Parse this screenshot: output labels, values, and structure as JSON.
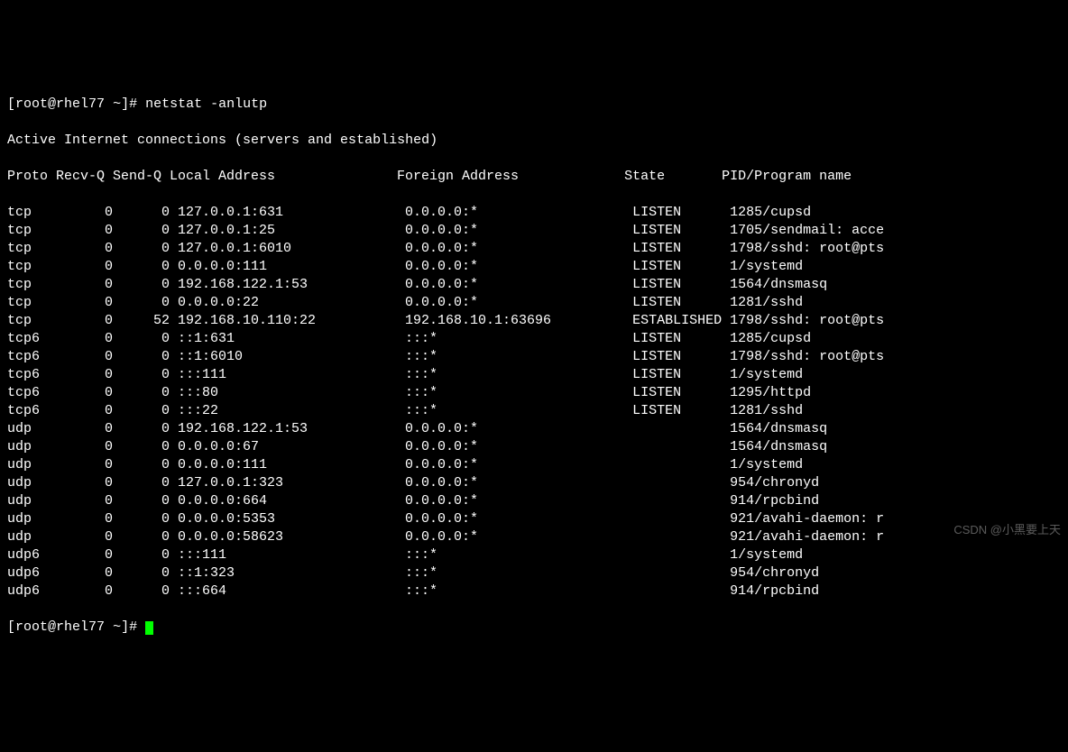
{
  "prompt1": {
    "open": "[",
    "user": "root",
    "at": "@",
    "host": "rhel77",
    "path": " ~",
    "close": "]#",
    "cmd": " netstat -anlutp"
  },
  "heading": "Active Internet connections (servers and established)",
  "cols": {
    "proto": "Proto",
    "recvq": "Recv-Q",
    "sendq": "Send-Q",
    "local": "Local Address",
    "foreign": "Foreign Address",
    "state": "State",
    "pid": "PID/Program name"
  },
  "rows": [
    {
      "proto": "tcp",
      "recvq": "0",
      "sendq": "0",
      "local": "127.0.0.1:631",
      "foreign": "0.0.0.0:*",
      "state": "LISTEN",
      "pid": "1285/cupsd"
    },
    {
      "proto": "tcp",
      "recvq": "0",
      "sendq": "0",
      "local": "127.0.0.1:25",
      "foreign": "0.0.0.0:*",
      "state": "LISTEN",
      "pid": "1705/sendmail: acce"
    },
    {
      "proto": "tcp",
      "recvq": "0",
      "sendq": "0",
      "local": "127.0.0.1:6010",
      "foreign": "0.0.0.0:*",
      "state": "LISTEN",
      "pid": "1798/sshd: root@pts"
    },
    {
      "proto": "tcp",
      "recvq": "0",
      "sendq": "0",
      "local": "0.0.0.0:111",
      "foreign": "0.0.0.0:*",
      "state": "LISTEN",
      "pid": "1/systemd"
    },
    {
      "proto": "tcp",
      "recvq": "0",
      "sendq": "0",
      "local": "192.168.122.1:53",
      "foreign": "0.0.0.0:*",
      "state": "LISTEN",
      "pid": "1564/dnsmasq"
    },
    {
      "proto": "tcp",
      "recvq": "0",
      "sendq": "0",
      "local": "0.0.0.0:22",
      "foreign": "0.0.0.0:*",
      "state": "LISTEN",
      "pid": "1281/sshd"
    },
    {
      "proto": "tcp",
      "recvq": "0",
      "sendq": "52",
      "local": "192.168.10.110:22",
      "foreign": "192.168.10.1:63696",
      "state": "ESTABLISHED",
      "pid": "1798/sshd: root@pts"
    },
    {
      "proto": "tcp6",
      "recvq": "0",
      "sendq": "0",
      "local": "::1:631",
      "foreign": ":::*",
      "state": "LISTEN",
      "pid": "1285/cupsd"
    },
    {
      "proto": "tcp6",
      "recvq": "0",
      "sendq": "0",
      "local": "::1:6010",
      "foreign": ":::*",
      "state": "LISTEN",
      "pid": "1798/sshd: root@pts"
    },
    {
      "proto": "tcp6",
      "recvq": "0",
      "sendq": "0",
      "local": ":::111",
      "foreign": ":::*",
      "state": "LISTEN",
      "pid": "1/systemd"
    },
    {
      "proto": "tcp6",
      "recvq": "0",
      "sendq": "0",
      "local": ":::80",
      "foreign": ":::*",
      "state": "LISTEN",
      "pid": "1295/httpd"
    },
    {
      "proto": "tcp6",
      "recvq": "0",
      "sendq": "0",
      "local": ":::22",
      "foreign": ":::*",
      "state": "LISTEN",
      "pid": "1281/sshd"
    },
    {
      "proto": "udp",
      "recvq": "0",
      "sendq": "0",
      "local": "192.168.122.1:53",
      "foreign": "0.0.0.0:*",
      "state": "",
      "pid": "1564/dnsmasq"
    },
    {
      "proto": "udp",
      "recvq": "0",
      "sendq": "0",
      "local": "0.0.0.0:67",
      "foreign": "0.0.0.0:*",
      "state": "",
      "pid": "1564/dnsmasq"
    },
    {
      "proto": "udp",
      "recvq": "0",
      "sendq": "0",
      "local": "0.0.0.0:111",
      "foreign": "0.0.0.0:*",
      "state": "",
      "pid": "1/systemd"
    },
    {
      "proto": "udp",
      "recvq": "0",
      "sendq": "0",
      "local": "127.0.0.1:323",
      "foreign": "0.0.0.0:*",
      "state": "",
      "pid": "954/chronyd"
    },
    {
      "proto": "udp",
      "recvq": "0",
      "sendq": "0",
      "local": "0.0.0.0:664",
      "foreign": "0.0.0.0:*",
      "state": "",
      "pid": "914/rpcbind"
    },
    {
      "proto": "udp",
      "recvq": "0",
      "sendq": "0",
      "local": "0.0.0.0:5353",
      "foreign": "0.0.0.0:*",
      "state": "",
      "pid": "921/avahi-daemon: r"
    },
    {
      "proto": "udp",
      "recvq": "0",
      "sendq": "0",
      "local": "0.0.0.0:58623",
      "foreign": "0.0.0.0:*",
      "state": "",
      "pid": "921/avahi-daemon: r"
    },
    {
      "proto": "udp6",
      "recvq": "0",
      "sendq": "0",
      "local": ":::111",
      "foreign": ":::*",
      "state": "",
      "pid": "1/systemd"
    },
    {
      "proto": "udp6",
      "recvq": "0",
      "sendq": "0",
      "local": "::1:323",
      "foreign": ":::*",
      "state": "",
      "pid": "954/chronyd"
    },
    {
      "proto": "udp6",
      "recvq": "0",
      "sendq": "0",
      "local": ":::664",
      "foreign": ":::*",
      "state": "",
      "pid": "914/rpcbind"
    }
  ],
  "prompt2": {
    "open": "[",
    "user": "root",
    "at": "@",
    "host": "rhel77",
    "path": " ~",
    "close": "]# "
  },
  "watermark": "CSDN @小黑要上天"
}
